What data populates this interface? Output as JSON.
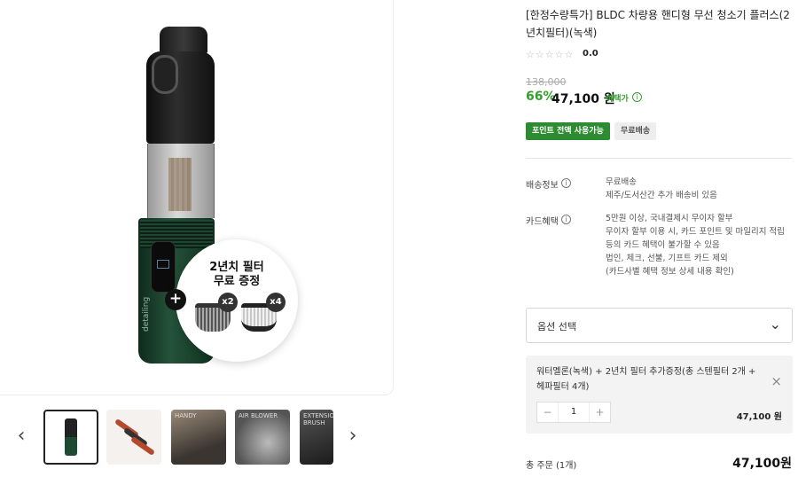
{
  "product": {
    "title": "[한정수량특가] BLDC 차량용 핸디형 무선 청소기 플러스(2년치필터)(녹색)",
    "rating_stars": "☆☆☆☆☆",
    "rating_value": "0.0",
    "original_price": "138,000",
    "discount_rate": "66%",
    "sale_price": "47,100 원",
    "benefit_label": "혜택가",
    "tags": [
      "포인트 전액 사용가능",
      "무료배송"
    ]
  },
  "promo": {
    "title_line1": "2년치 필터",
    "title_line2": "무료 증정",
    "plus": "+",
    "badge_a": "x2",
    "badge_b": "x4",
    "brand": "detailing"
  },
  "gallery": {
    "prev_arrow": "‹",
    "next_arrow": "›",
    "thumbs": [
      {
        "label": ""
      },
      {
        "label": ""
      },
      {
        "label": "HANDY"
      },
      {
        "label": "AIR BLOWER"
      },
      {
        "label": "EXTENSION BRUSH"
      }
    ]
  },
  "shipping": {
    "label": "배송정보",
    "lines": [
      "무료배송",
      "제주/도서산간 추가 배송비 있음"
    ]
  },
  "card": {
    "label": "카드혜택",
    "lines": [
      "5만원 이상, 국내결제시 무이자 할부",
      "무이자 할부 이용 시, 카드 포인트 및 마일리지 적립",
      "등의 카드 혜택이 불가할 수 있음",
      "법인, 체크, 선불, 기프트 카드 제외",
      "(카드사별 혜택 정보 상세 내용 확인)"
    ]
  },
  "option": {
    "placeholder": "옵션 선택",
    "chevron": "⌄"
  },
  "selected": {
    "name": "워터멜론(녹색) + 2년치 필터 추가증정(총 스텐필터 2개 + 헤파필터 4개)",
    "close": "×",
    "minus": "−",
    "plus": "+",
    "quantity": "1",
    "price": "47,100 원"
  },
  "total": {
    "label": "총 주문 (1개)",
    "price": "47,100원"
  },
  "colors": {
    "accent_green": "#34a02c",
    "tag_green": "#2e8b32",
    "body_green": "#24533a"
  },
  "icons": {
    "info": "ⓘ"
  }
}
